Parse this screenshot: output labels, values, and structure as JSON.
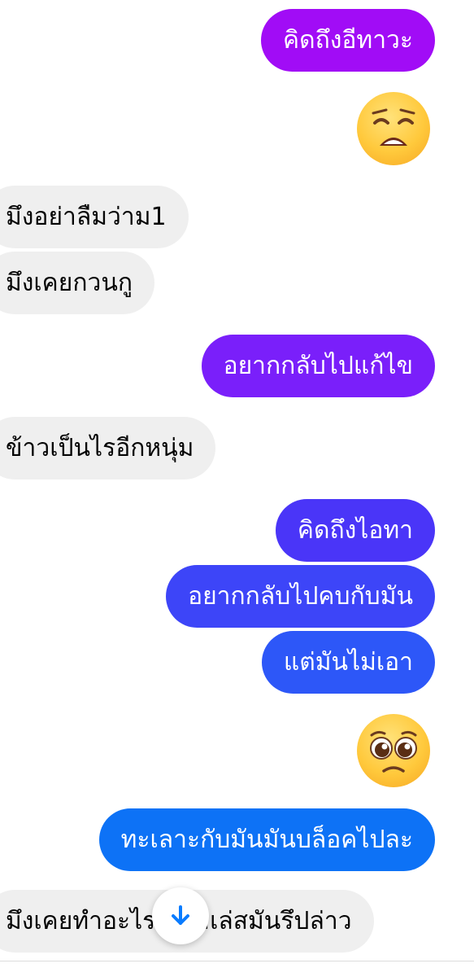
{
  "messages": [
    {
      "id": 1,
      "direction": "outgoing",
      "type": "text",
      "text": "คิดถึงอีทาวะ",
      "color": "#a10cf6"
    },
    {
      "id": 2,
      "direction": "outgoing",
      "type": "emoji",
      "emoji": "weary-face-emoji"
    },
    {
      "id": 3,
      "direction": "incoming",
      "type": "text",
      "text": "มึงอย่าลืมว่าม1"
    },
    {
      "id": 4,
      "direction": "incoming",
      "type": "text",
      "text": "มึงเคยกวนกู"
    },
    {
      "id": 5,
      "direction": "outgoing",
      "type": "text",
      "text": "อยากกลับไปแก้ไข",
      "color": "#7a1ffa"
    },
    {
      "id": 6,
      "direction": "incoming",
      "type": "text",
      "text": "ข้าวเป็นไรอีกหนุ่ม"
    },
    {
      "id": 7,
      "direction": "outgoing",
      "type": "text",
      "text": "คิดถึงไอทา",
      "color": "#4a35f8"
    },
    {
      "id": 8,
      "direction": "outgoing",
      "type": "text",
      "text": "อยากกลับไปคบกับมัน",
      "color": "#3d45f8"
    },
    {
      "id": 9,
      "direction": "outgoing",
      "type": "text",
      "text": "แต่มันไม่เอา",
      "color": "#2d57f8"
    },
    {
      "id": 10,
      "direction": "outgoing",
      "type": "emoji",
      "emoji": "pleading-face-emoji"
    },
    {
      "id": 11,
      "direction": "outgoing",
      "type": "text",
      "text": "ทะเลาะกับมันมันบล็อคไปละ",
      "color": "#0d72f6"
    },
    {
      "id": 12,
      "direction": "incoming",
      "type": "text",
      "text": "มึงเคยทำอะไรไว้ไม่เล่สมันรึปล่าว"
    }
  ],
  "scroll_to_bottom": {
    "icon": "arrow-down-icon",
    "color": "#0a7cff"
  }
}
